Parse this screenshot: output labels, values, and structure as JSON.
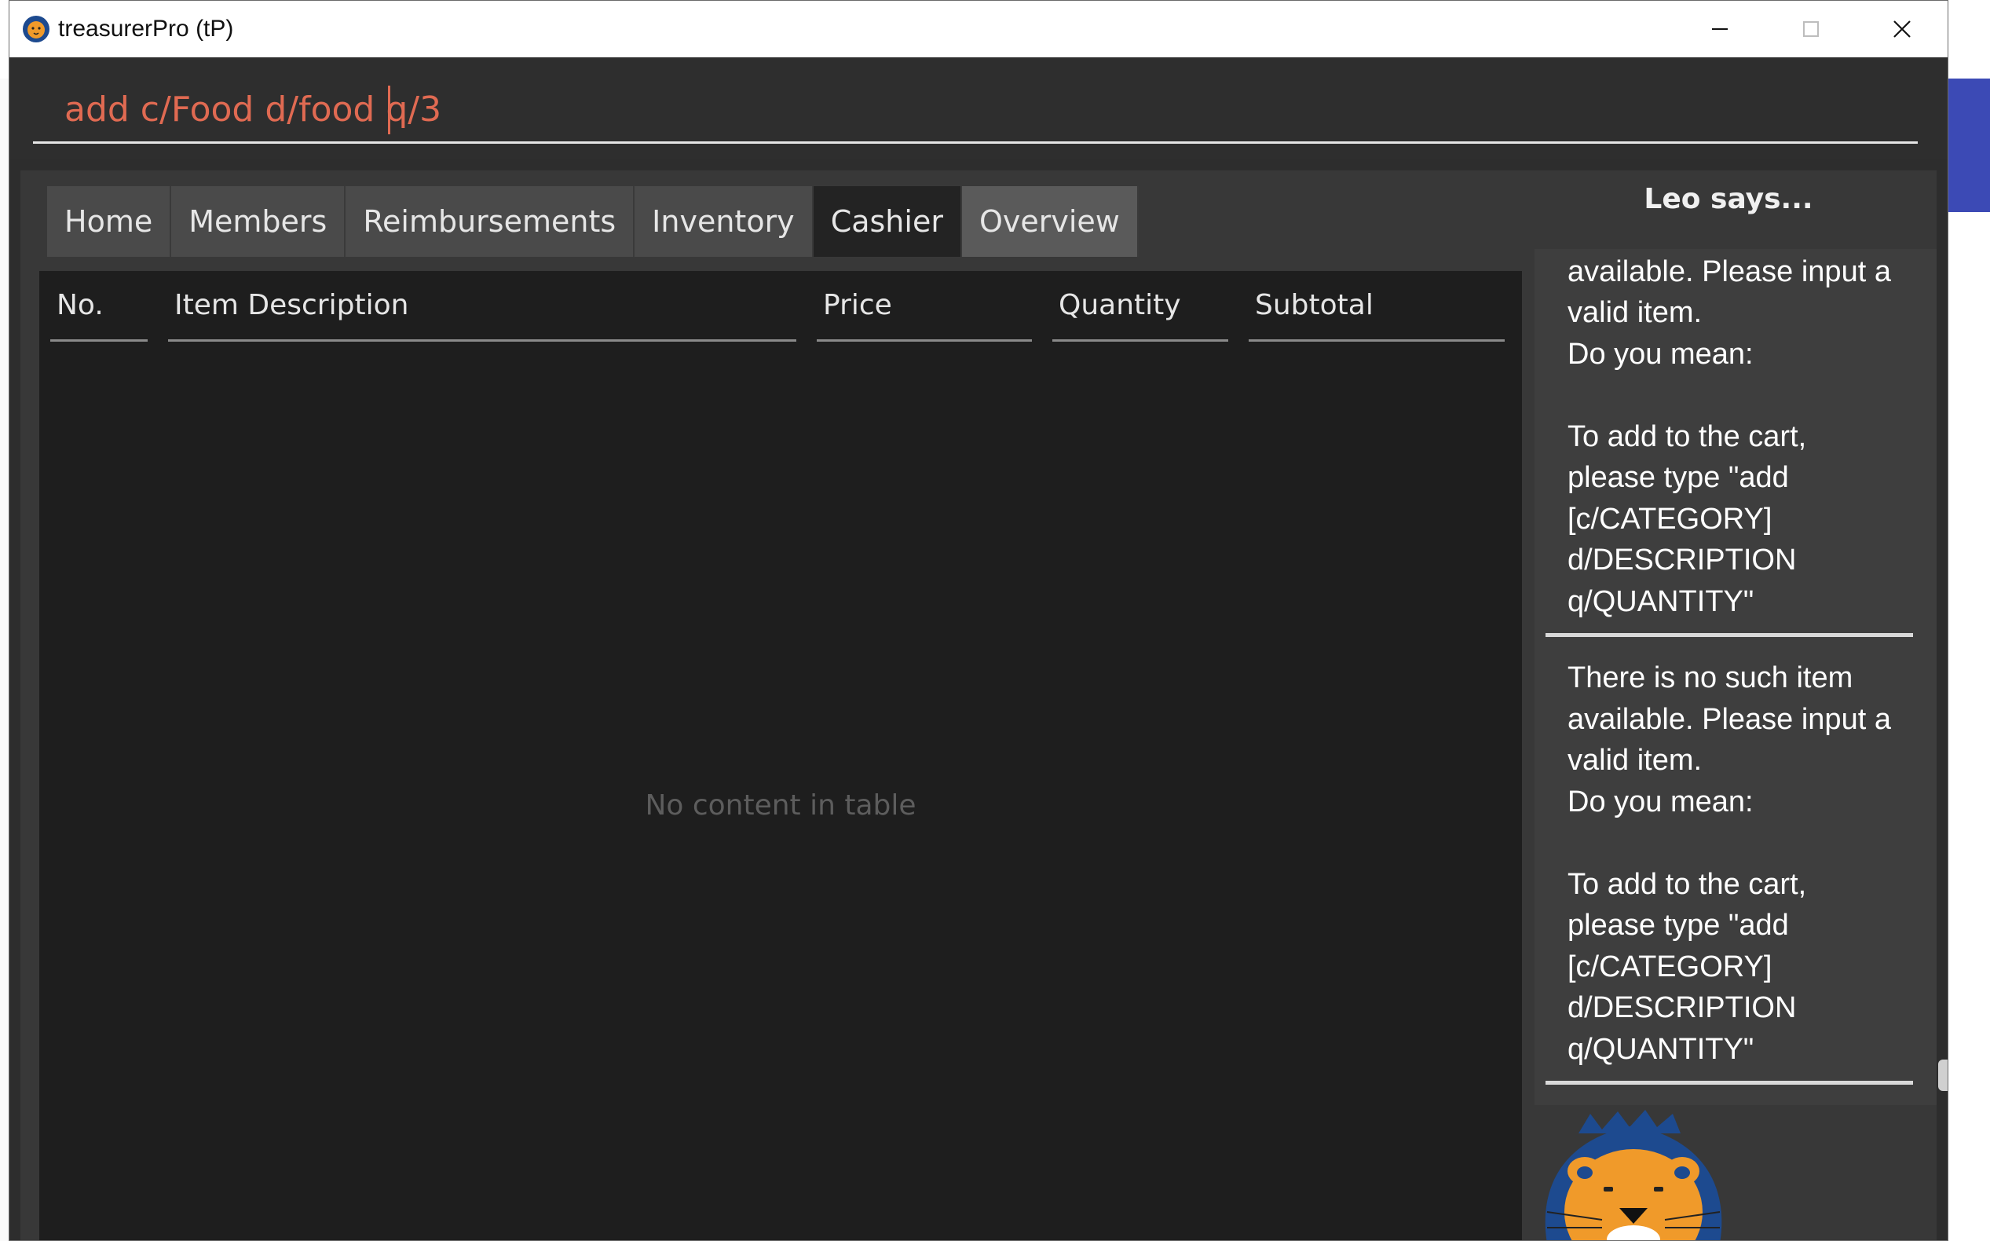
{
  "window": {
    "title": "treasurerPro (tP)",
    "app_icon": "lion-icon"
  },
  "controls": {
    "minimize": "minimize-icon",
    "maximize": "maximize-icon",
    "close": "close-icon"
  },
  "command": {
    "value": "add c/Food d/food q/3"
  },
  "tabs": [
    {
      "label": "Home"
    },
    {
      "label": "Members"
    },
    {
      "label": "Reimbursements"
    },
    {
      "label": "Inventory"
    },
    {
      "label": "Cashier"
    },
    {
      "label": "Overview"
    }
  ],
  "active_tab": "Cashier",
  "table": {
    "columns": [
      "No.",
      "Item Description",
      "Price",
      "Quantity",
      "Subtotal"
    ],
    "empty_message": "No content in table"
  },
  "assistant": {
    "header": "Leo says...",
    "messages": [
      "There is no such item available. Please input a valid item.\nDo you mean:\n\nTo add to the cart, please type \"add [c/CATEGORY] d/DESCRIPTION q/QUANTITY\"",
      "There is no such item available. Please input a valid item.\nDo you mean:\n\nTo add to the cart, please type \"add [c/CATEGORY] d/DESCRIPTION q/QUANTITY\""
    ]
  },
  "colors": {
    "command_text": "#e06a52",
    "background": "#2d2d2d",
    "desktop_accent": "#3c4ab5"
  }
}
